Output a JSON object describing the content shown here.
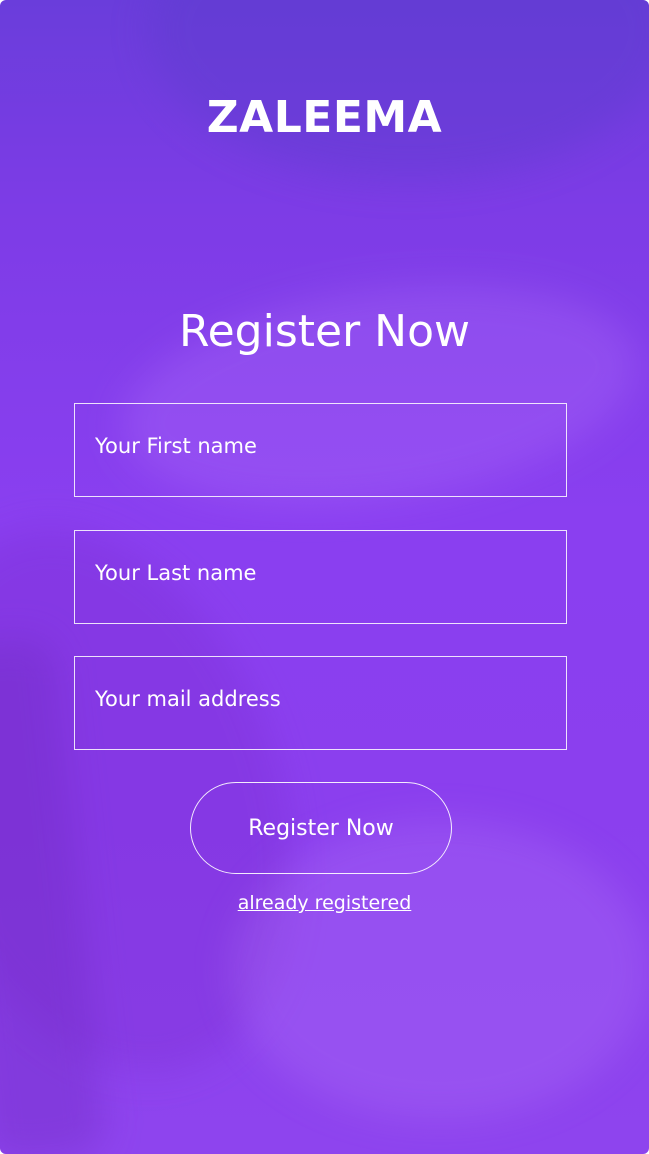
{
  "app": {
    "logo": "ZALEEMA"
  },
  "form": {
    "heading": "Register Now",
    "first_name": {
      "placeholder": "Your First name",
      "value": ""
    },
    "last_name": {
      "placeholder": "Your Last name",
      "value": ""
    },
    "email": {
      "placeholder": "Your mail address",
      "value": ""
    },
    "submit_label": "Register Now",
    "login_link": "already registered"
  },
  "colors": {
    "background_top": "#6a3ddb",
    "background_main": "#8a3ff0",
    "foreground": "#ffffff"
  }
}
